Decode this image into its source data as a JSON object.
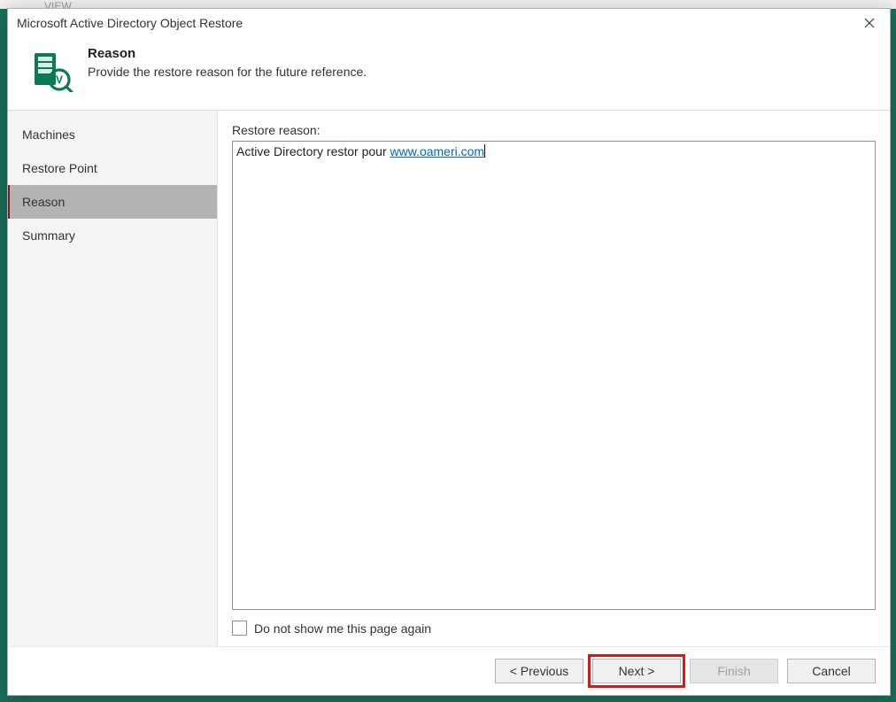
{
  "bg_ribbon_hint": "VIEW",
  "dialog": {
    "title": "Microsoft Active Directory Object Restore",
    "header": {
      "title": "Reason",
      "subtitle": "Provide the restore reason for the future reference.",
      "icon_name": "restore-server-icon"
    },
    "sidebar": {
      "items": [
        {
          "label": "Machines",
          "selected": false
        },
        {
          "label": "Restore Point",
          "selected": false
        },
        {
          "label": "Reason",
          "selected": true
        },
        {
          "label": "Summary",
          "selected": false
        }
      ]
    },
    "main": {
      "field_label": "Restore reason:",
      "reason_text_plain": "Active Directory restor pour ",
      "reason_text_link": "www.oameri.com",
      "checkbox_label": "Do not show me this page again",
      "checkbox_checked": false
    },
    "footer": {
      "previous_label": "< Previous",
      "next_label": "Next >",
      "finish_label": "Finish",
      "cancel_label": "Cancel",
      "finish_enabled": false,
      "highlight_next": true
    }
  }
}
